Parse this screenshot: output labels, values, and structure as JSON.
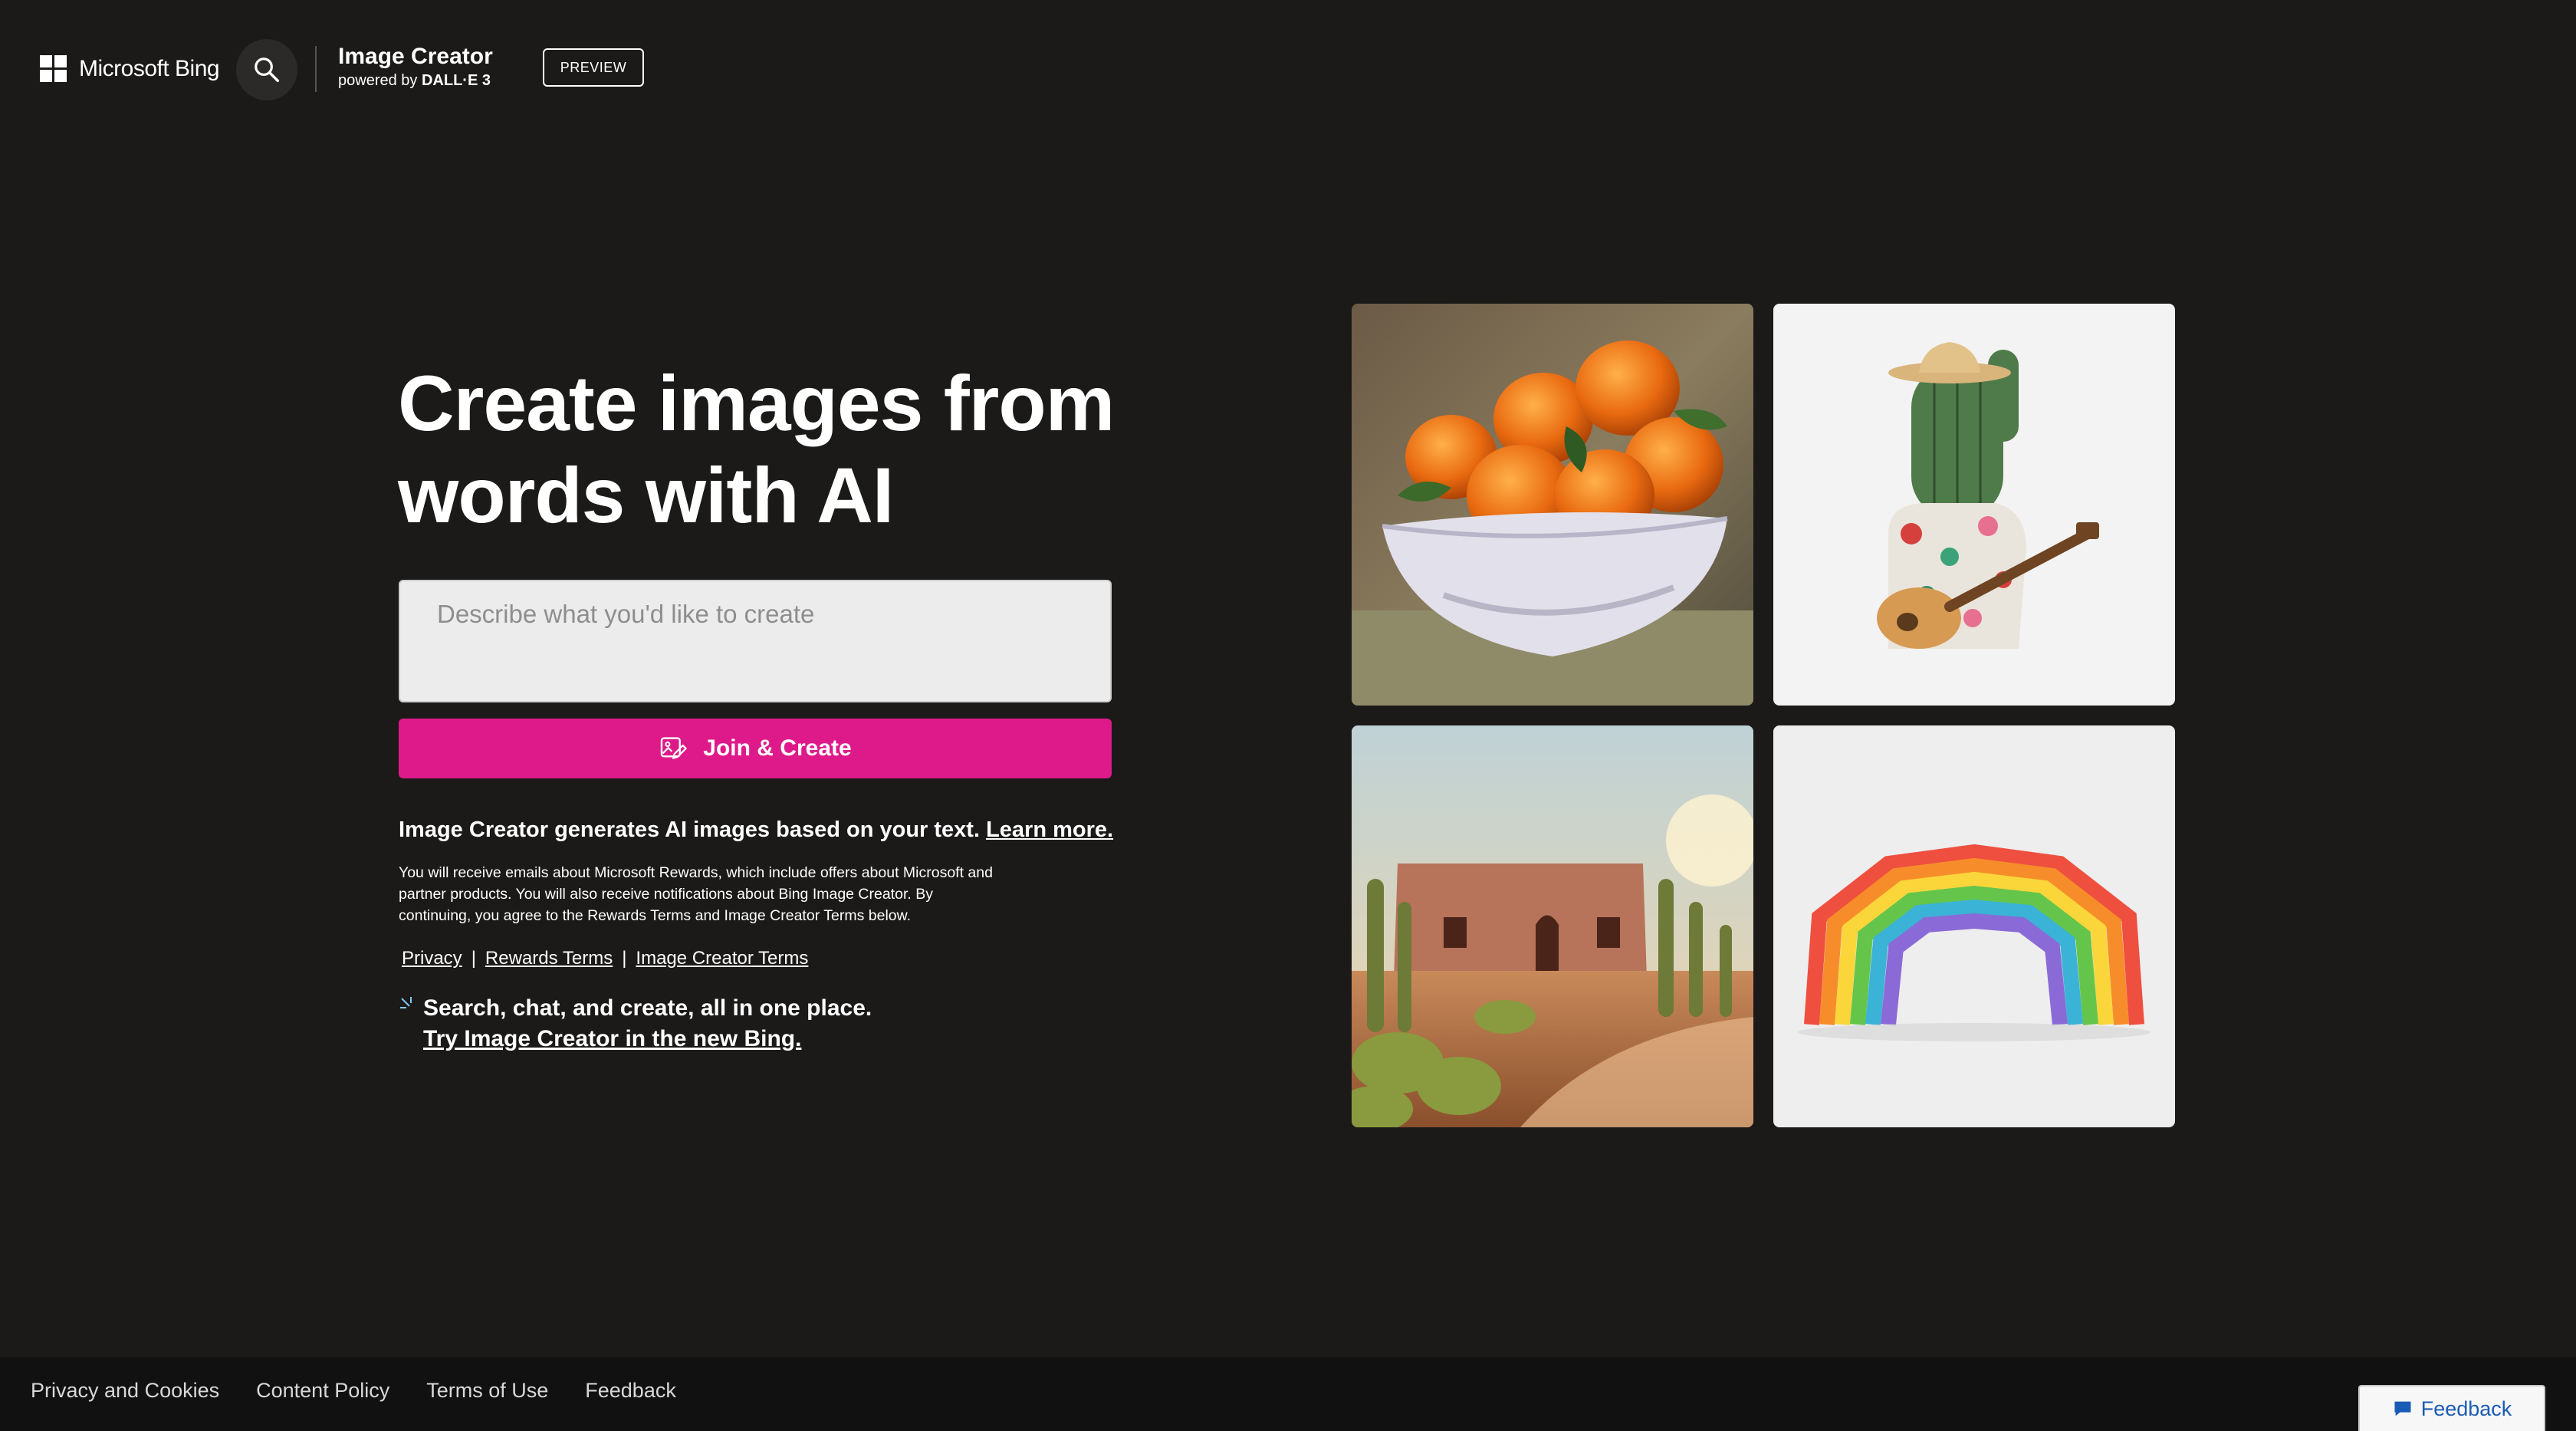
{
  "header": {
    "brand_name": "Microsoft Bing",
    "search_icon": "search-icon",
    "product_title": "Image Creator",
    "product_sub_prefix": "powered by ",
    "product_sub_model": "DALL·E 3",
    "preview_label": "PREVIEW"
  },
  "hero": {
    "headline": "Create images from words with AI",
    "prompt_placeholder": "Describe what you'd like to create",
    "join_label": "Join & Create",
    "join_icon": "image-create-icon",
    "desc_text": "Image Creator generates AI images based on your text.",
    "learn_more": "Learn more.",
    "fine_print": "You will receive emails about Microsoft Rewards, which include offers about Microsoft and partner products. You will also receive notifications about Bing Image Creator. By continuing, you agree to the Rewards Terms and Image Creator Terms below.",
    "terms": {
      "privacy": "Privacy",
      "rewards_terms": "Rewards Terms",
      "image_creator_terms": "Image Creator Terms",
      "separator": "|"
    },
    "promo_line1": "Search, chat, and create, all in one place.",
    "promo_line2": "Try Image Creator in the new Bing."
  },
  "gallery": [
    {
      "subject": "bowl of oranges painting"
    },
    {
      "subject": "cactus playing guitar"
    },
    {
      "subject": "desert adobe house with cacti"
    },
    {
      "subject": "paper rainbow"
    }
  ],
  "footer": {
    "links": [
      "Privacy and Cookies",
      "Content Policy",
      "Terms of Use",
      "Feedback"
    ],
    "feedback_button": "Feedback"
  },
  "colors": {
    "background": "#1b1a19",
    "accent": "#de1a8a",
    "footer_bg": "#111111",
    "feedback_text": "#1a5bb5"
  }
}
